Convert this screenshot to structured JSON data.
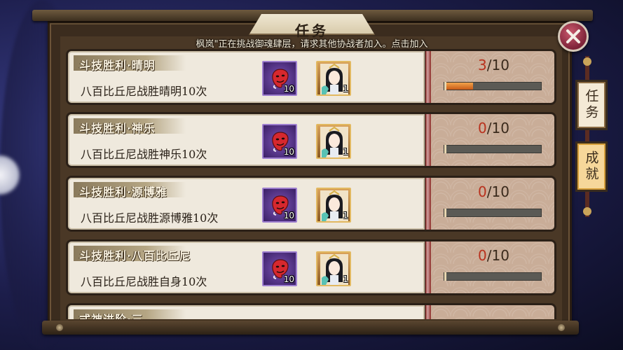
{
  "header": {
    "title": "任务"
  },
  "banner": {
    "text": "枫岚\"正在挑战御魂肆层，请求其他协战者加入。点击加入"
  },
  "tasks": [
    {
      "title": "斗技胜利·晴明",
      "desc": "八百比丘尼战胜晴明10次",
      "rewards": [
        {
          "icon": "mask-icon",
          "count": "10"
        },
        {
          "icon": "yaobikuni-icon",
          "count": "1"
        }
      ],
      "progress": {
        "current": "3",
        "total": "/10",
        "fraction": 0.3
      }
    },
    {
      "title": "斗技胜利·神乐",
      "desc": "八百比丘尼战胜神乐10次",
      "rewards": [
        {
          "icon": "mask-icon",
          "count": "10"
        },
        {
          "icon": "yaobikuni-icon",
          "count": "1"
        }
      ],
      "progress": {
        "current": "0",
        "total": "/10",
        "fraction": 0
      }
    },
    {
      "title": "斗技胜利·源博雅",
      "desc": "八百比丘尼战胜源博雅10次",
      "rewards": [
        {
          "icon": "mask-icon",
          "count": "10"
        },
        {
          "icon": "yaobikuni-icon",
          "count": "1"
        }
      ],
      "progress": {
        "current": "0",
        "total": "/10",
        "fraction": 0
      }
    },
    {
      "title": "斗技胜利·八百比丘尼",
      "desc": "八百比丘尼战胜自身10次",
      "rewards": [
        {
          "icon": "mask-icon",
          "count": "10"
        },
        {
          "icon": "yaobikuni-icon",
          "count": "1"
        }
      ],
      "progress": {
        "current": "0",
        "total": "/10",
        "fraction": 0
      }
    },
    {
      "title": "式神进阶·三",
      "desc": "",
      "rewards": [],
      "progress": {
        "current": "",
        "total": "",
        "fraction": 0
      }
    }
  ],
  "side_tabs": [
    {
      "label": "任务",
      "active": false
    },
    {
      "label": "成就",
      "active": true
    }
  ],
  "close": {
    "icon": "close-icon"
  },
  "colors": {
    "progress_fill": "#e07a2a",
    "progress_current": "#b9321e",
    "close_button": "#a03a50"
  }
}
